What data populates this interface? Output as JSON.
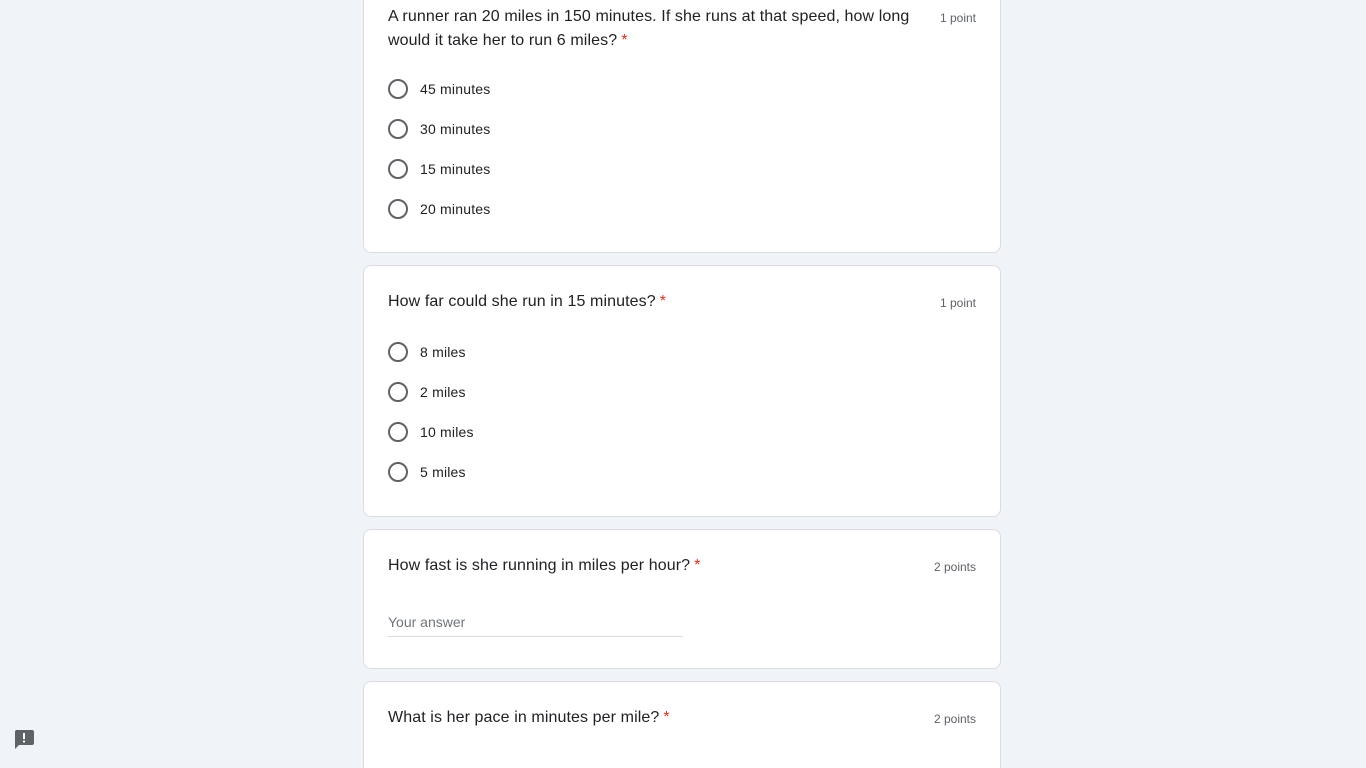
{
  "questions": [
    {
      "title": "A runner ran 20 miles in 150 minutes. If she runs at that speed, how long would it take her to run 6 miles?",
      "required_mark": "*",
      "points": "1 point",
      "options": [
        "45 minutes",
        "30 minutes",
        "15 minutes",
        "20 minutes"
      ]
    },
    {
      "title": "How far could she run in 15 minutes?",
      "required_mark": "*",
      "points": "1 point",
      "options": [
        "8 miles",
        "2 miles",
        "10 miles",
        "5 miles"
      ]
    },
    {
      "title": "How fast is she running in miles per hour?",
      "required_mark": "*",
      "points": "2 points",
      "answer_placeholder": "Your answer"
    },
    {
      "title": "What is her pace in minutes per mile?",
      "required_mark": "*",
      "points": "2 points"
    }
  ],
  "report_icon": "report-problem-icon"
}
